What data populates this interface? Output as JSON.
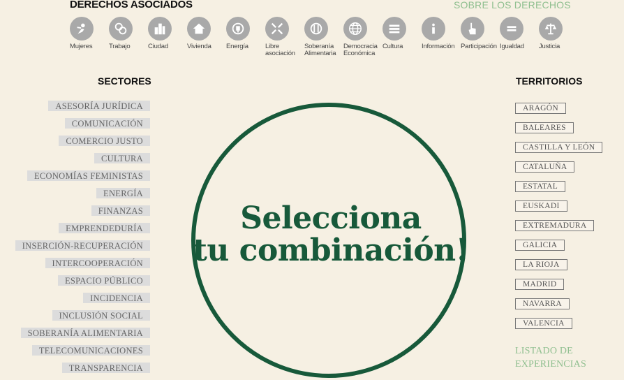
{
  "header": {
    "rights_title": "DERECHOS ASOCIADOS",
    "about_link": "SOBRE LOS DERECHOS"
  },
  "rights": [
    {
      "label": "Mujeres",
      "icon": "women-icon"
    },
    {
      "label": "Trabajo",
      "icon": "work-icon"
    },
    {
      "label": "Ciudad",
      "icon": "city-icon"
    },
    {
      "label": "Vivienda",
      "icon": "house-icon"
    },
    {
      "label": "Energía",
      "icon": "plug-icon"
    },
    {
      "label": "Libre asociación",
      "icon": "association-icon"
    },
    {
      "label": "Soberanía Alimentaria",
      "icon": "food-icon"
    },
    {
      "label": "Democracia Económica",
      "icon": "globe-icon"
    },
    {
      "label": "Cultura",
      "icon": "books-icon"
    },
    {
      "label": "Información",
      "icon": "info-icon"
    },
    {
      "label": "Participación",
      "icon": "hand-icon"
    },
    {
      "label": "Igualdad",
      "icon": "equal-icon"
    },
    {
      "label": "Justicia",
      "icon": "scales-icon"
    }
  ],
  "sectors": {
    "title": "SECTORES",
    "items": [
      "ASESORÍA JURÍDICA",
      "COMUNICACIÓN",
      "COMERCIO JUSTO",
      "CULTURA",
      "ECONOMÍAS FEMINISTAS",
      "ENERGÍA",
      "FINANZAS",
      "EMPRENDEDURÍA",
      "INSERCIÓN-RECUPERACIÓN",
      "INTERCOOPERACIÓN",
      "ESPACIO PÚBLICO",
      "INCIDENCIA",
      "INCLUSIÓN SOCIAL",
      "SOBERANÍA ALIMENTARIA",
      "TELECOMUNICACIONES",
      "TRANSPARENCIA"
    ]
  },
  "territories": {
    "title": "TERRITORIOS",
    "items": [
      "ARAGÓN",
      "BALEARES",
      "CASTILLA Y LEÓN",
      "CATALUÑA",
      "ESTATAL",
      "EUSKADI",
      "EXTREMADURA",
      "GALICIA",
      "LA RIOJA",
      "MADRID",
      "NAVARRA",
      "VALENCIA"
    ],
    "listing_link": "LISTADO DE EXPERIENCIAS"
  },
  "center": {
    "line1": "Selecciona",
    "line2": "tu combinación!"
  },
  "colors": {
    "background": "#f6f0e3",
    "accent_green": "#17593a",
    "link_green": "#8fbf8f",
    "icon_grey": "#a9a9a9"
  }
}
